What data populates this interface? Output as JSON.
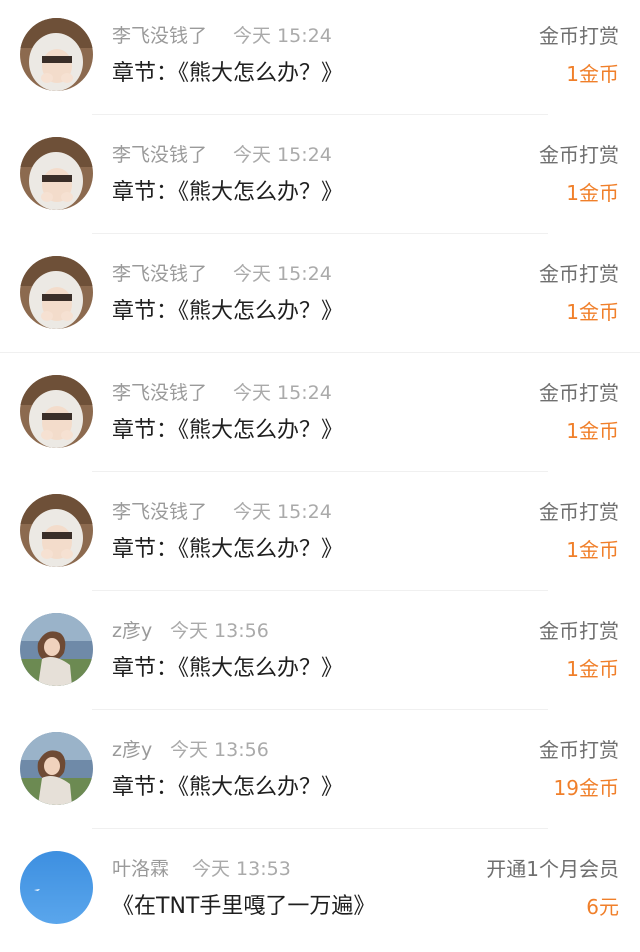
{
  "records": [
    {
      "avatar": "hooded-person-avatar",
      "user": "李飞没钱了",
      "time": "今天 15:24",
      "chapter": "章节：《熊大怎么办？》",
      "kind": "金币打赏",
      "amount": "1金币"
    },
    {
      "avatar": "hooded-person-avatar",
      "user": "李飞没钱了",
      "time": "今天 15:24",
      "chapter": "章节：《熊大怎么办？》",
      "kind": "金币打赏",
      "amount": "1金币"
    },
    {
      "avatar": "hooded-person-avatar",
      "user": "李飞没钱了",
      "time": "今天 15:24",
      "chapter": "章节：《熊大怎么办？》",
      "kind": "金币打赏",
      "amount": "1金币"
    },
    {
      "avatar": "hooded-person-avatar",
      "user": "李飞没钱了",
      "time": "今天 15:24",
      "chapter": "章节：《熊大怎么办？》",
      "kind": "金币打赏",
      "amount": "1金币"
    },
    {
      "avatar": "hooded-person-avatar",
      "user": "李飞没钱了",
      "time": "今天 15:24",
      "chapter": "章节：《熊大怎么办？》",
      "kind": "金币打赏",
      "amount": "1金币"
    },
    {
      "avatar": "painted-girl-avatar",
      "user": "z彦y",
      "time": "今天 13:56",
      "chapter": "章节：《熊大怎么办？》",
      "kind": "金币打赏",
      "amount": "1金币"
    },
    {
      "avatar": "painted-girl-avatar",
      "user": "z彦y",
      "time": "今天 13:56",
      "chapter": "章节：《熊大怎么办？》",
      "kind": "金币打赏",
      "amount": "19金币"
    },
    {
      "avatar": "blue-sky-avatar",
      "user": "叶洛霖",
      "time": "今天 13:53",
      "chapter": "《在TNT手里嘎了一万遍》",
      "kind": "开通1个月会员",
      "amount": "6元"
    }
  ],
  "colors": {
    "amount": "#f07f2a",
    "username": "#9a9a9a",
    "chapter": "#1f1f1f"
  }
}
